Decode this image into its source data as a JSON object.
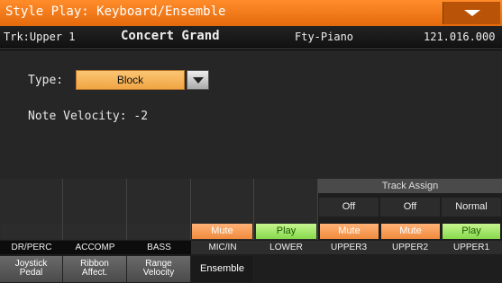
{
  "title": "Style Play: Keyboard/Ensemble",
  "track_info": {
    "track": "Trk:Upper 1",
    "sound": "Concert Grand",
    "bank": "Fty-Piano",
    "program": "121.016.000"
  },
  "main": {
    "type_label": "Type:",
    "type_value": "Block",
    "velocity": "Note Velocity: -2"
  },
  "mixer": {
    "track_assign_header": "Track Assign",
    "assign": [
      "Off",
      "Off",
      "Normal"
    ],
    "buttons": [
      "",
      "",
      "",
      "Mute",
      "Play",
      "Mute",
      "Mute",
      "Play"
    ],
    "tracks": [
      "DR/PERC",
      "ACCOMP",
      "BASS",
      "MIC/IN",
      "LOWER",
      "UPPER3",
      "UPPER2",
      "UPPER1"
    ]
  },
  "tabs": [
    {
      "line1": "Joystick",
      "line2": "Pedal"
    },
    {
      "line1": "Ribbon",
      "line2": "Affect."
    },
    {
      "line1": "Range",
      "line2": "Velocity"
    },
    {
      "line1": "Ensemble",
      "line2": ""
    }
  ]
}
